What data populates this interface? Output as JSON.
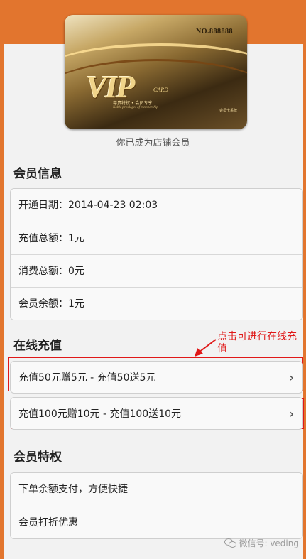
{
  "card": {
    "number": "NO.888888",
    "logo": "VIP",
    "logo_word": "CARD",
    "slogan_cn": "尊贵特权 • 会员专享",
    "slogan_en": "Noble privileges of membership",
    "system": "会员卡系统"
  },
  "member_note": "你已成为店铺会员",
  "member_info": {
    "title": "会员信息",
    "rows": [
      "开通日期：2014-04-23 02:03",
      "充值总额：1元",
      "消费总额：0元",
      "会员余额：1元"
    ]
  },
  "recharge": {
    "title": "在线充值",
    "annotation": "点击可进行在线充值",
    "options": [
      "充值50元赠5元  - 充值50送5元",
      "充值100元赠10元  - 充值100送10元"
    ],
    "chevron": "›"
  },
  "privileges": {
    "title": "会员特权",
    "rows": [
      "下单余额支付，方便快捷",
      "会员打折优惠"
    ]
  },
  "watermark": "微信号: veding",
  "colors": {
    "orange": "#e2752e",
    "annotation_red": "#e01818"
  }
}
